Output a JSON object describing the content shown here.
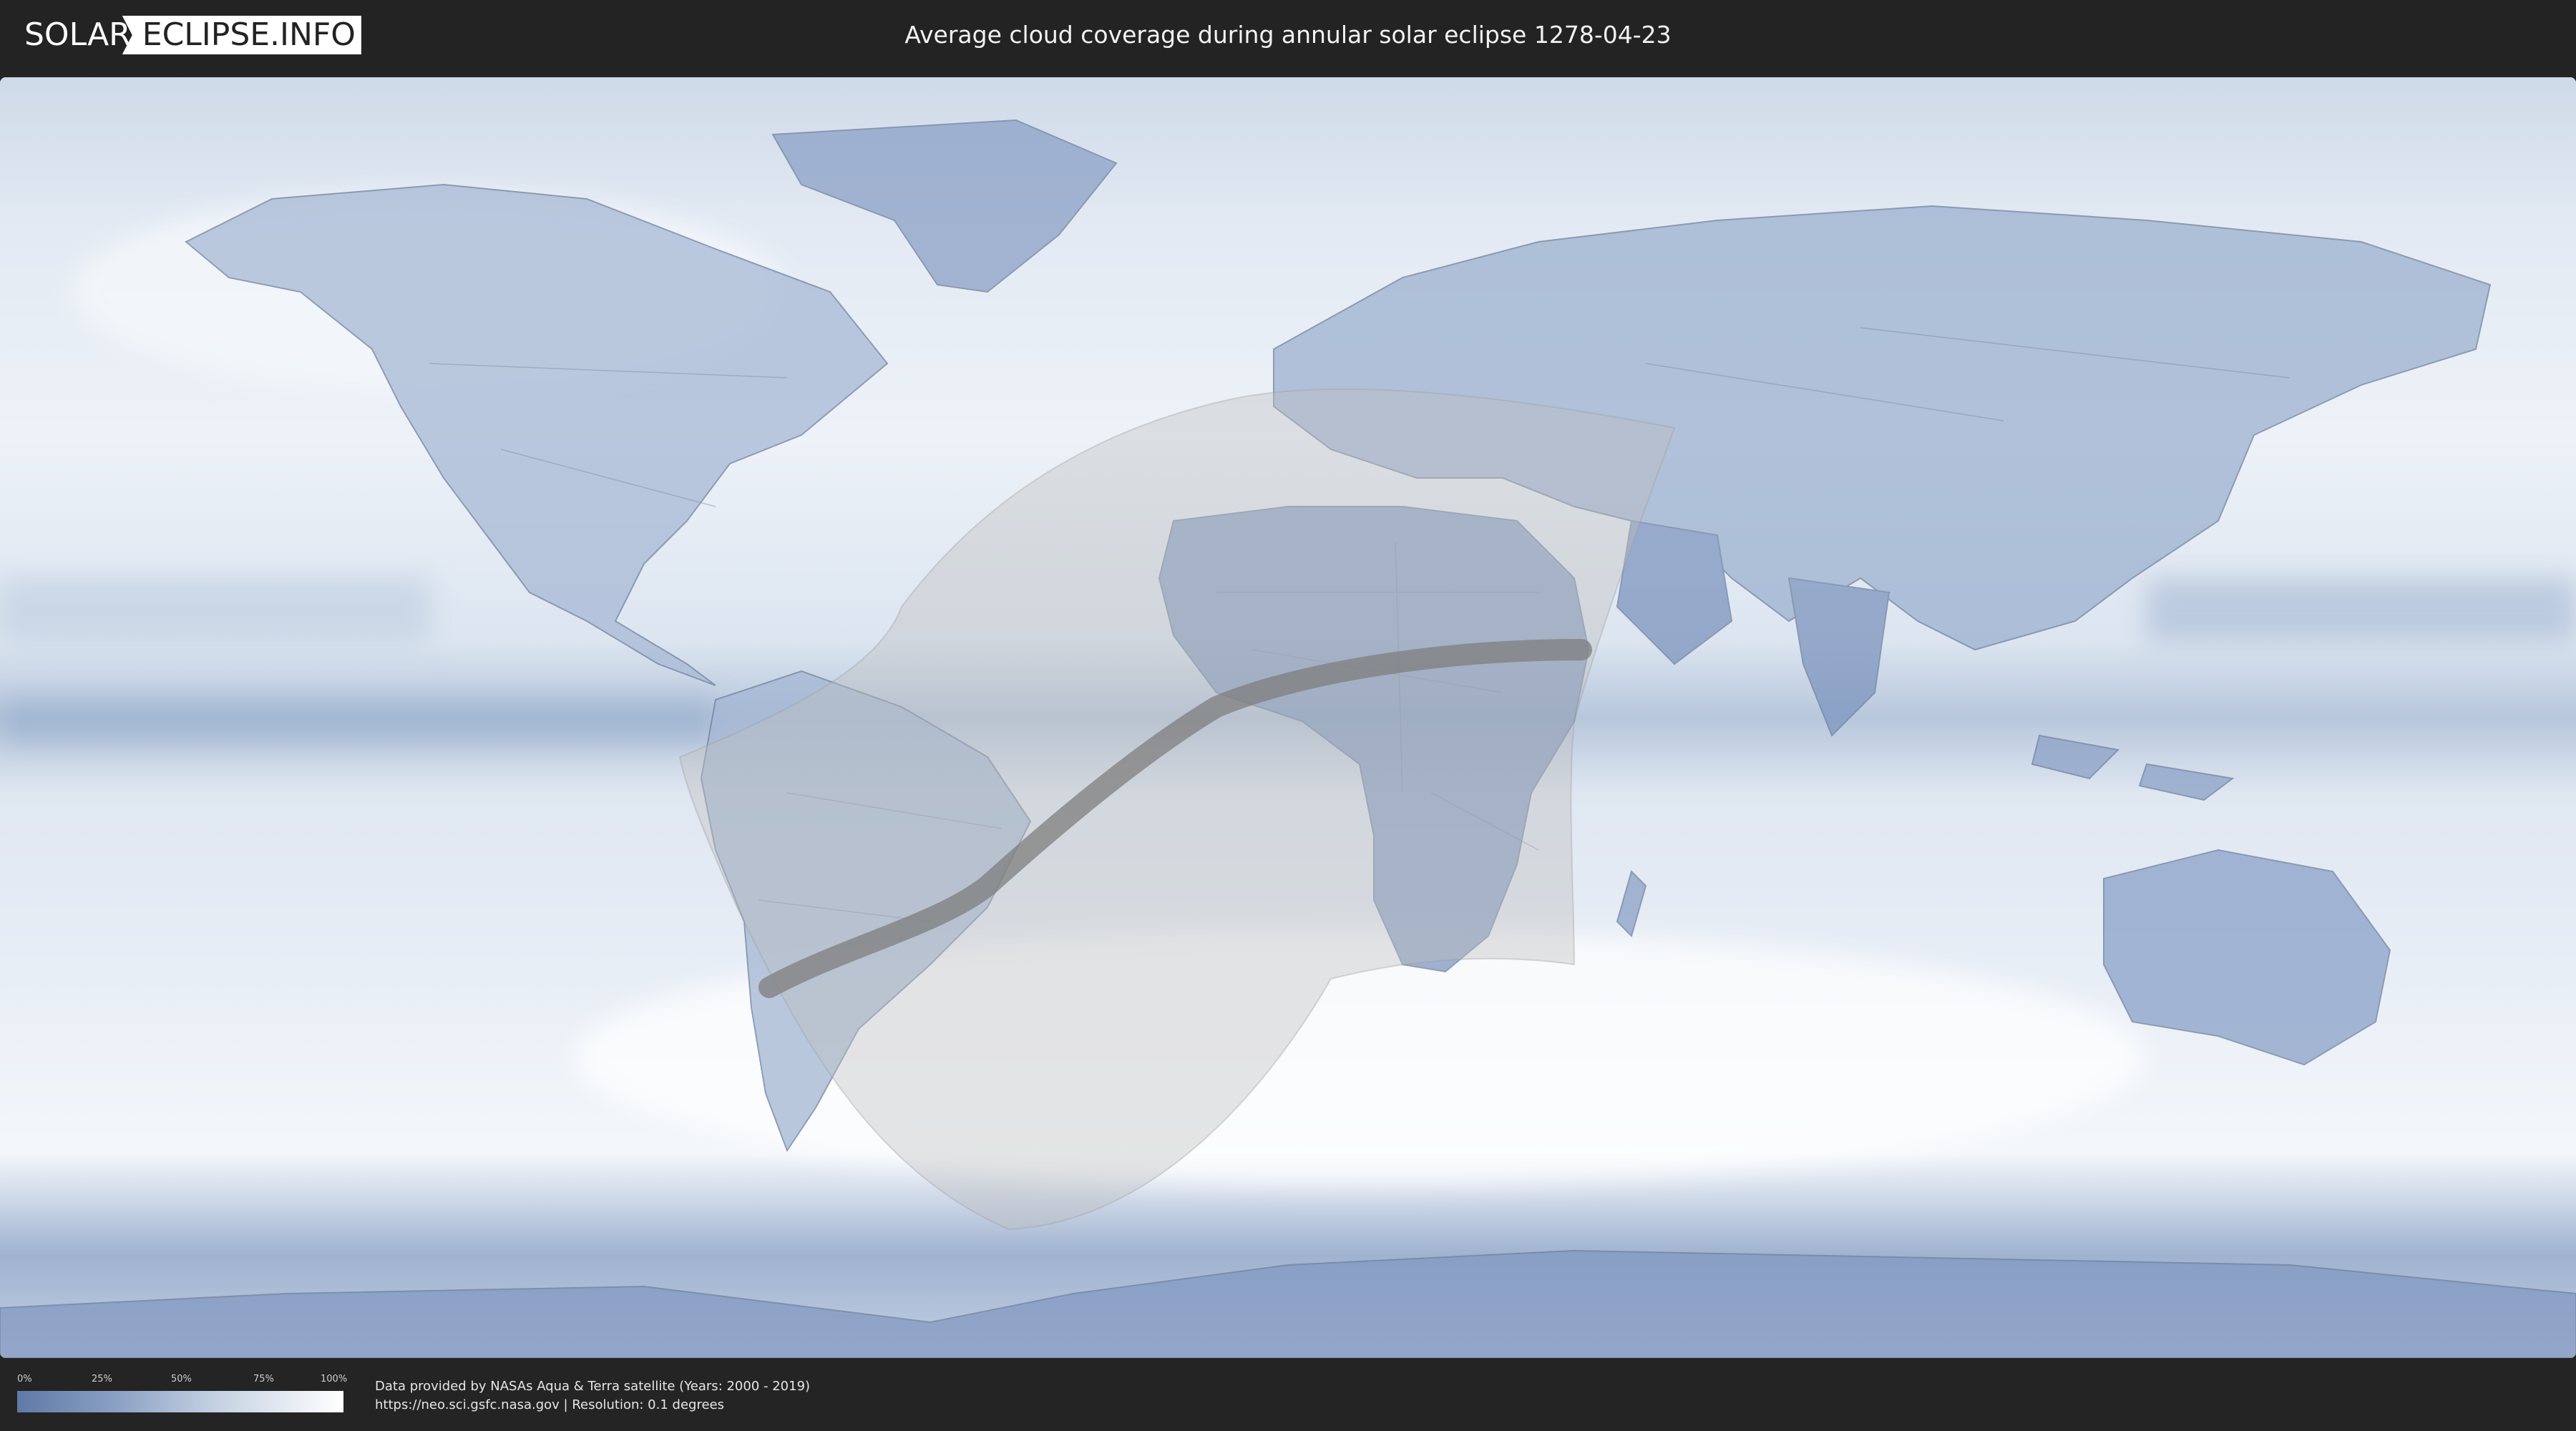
{
  "header": {
    "logo_left": "SOLAR",
    "logo_right": "ECLIPSE.INFO",
    "title": "Average cloud coverage during annular solar eclipse 1278-04-23"
  },
  "legend": {
    "ticks": [
      "0%",
      "25%",
      "50%",
      "75%",
      "100%"
    ],
    "gradient_start_color": "#5f7aa7",
    "gradient_end_color": "#ffffff"
  },
  "credits": {
    "line1": "Data provided by NASAs Aqua & Terra satellite (Years: 2000 - 2019)",
    "line2": "https://neo.sci.gsfc.nasa.gov | Resolution: 0.1 degrees"
  },
  "colors": {
    "background": "#242424",
    "cloud_clear": "#6f89b3",
    "cloud_full": "#ffffff",
    "eclipse_path": "#7d7d7d"
  }
}
